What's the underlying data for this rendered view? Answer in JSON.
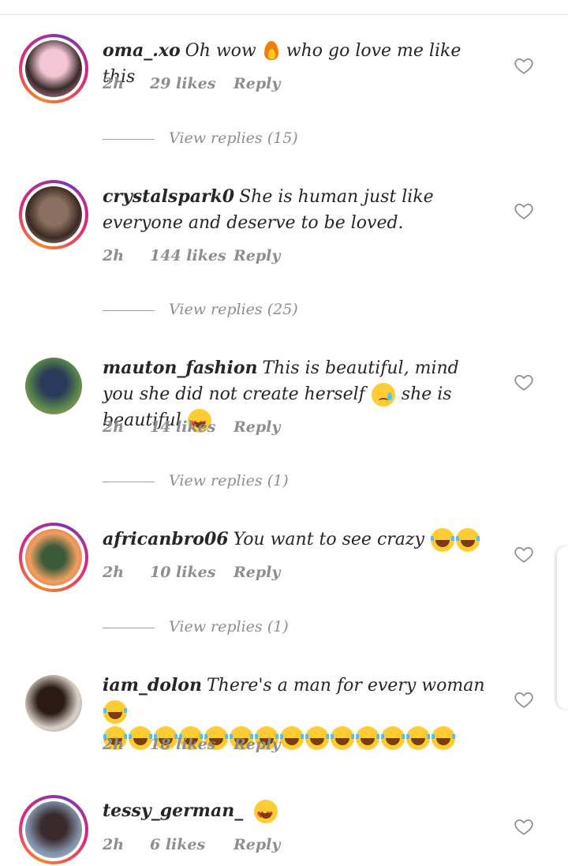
{
  "comments": [
    {
      "username": "oma_.xo",
      "text_parts": [
        "Oh wow",
        "who go love me like this"
      ],
      "time": "2h",
      "likes": "29 likes",
      "reply": "Reply",
      "view_replies": "View replies (15)",
      "avatar_colors": [
        "#f3c6d6",
        "#3a2a2a"
      ]
    },
    {
      "username": "crystalspark0",
      "text": "She is human just like everyone and deserve to be loved.",
      "time": "2h",
      "likes": "144 likes",
      "reply": "Reply",
      "view_replies": "View replies (25)",
      "avatar_colors": [
        "#8a7060",
        "#3a2a22"
      ]
    },
    {
      "username": "mauton_fashion",
      "text_parts": [
        "This is beautiful, mind you she did not create herself",
        "she is beautiful"
      ],
      "time": "2h",
      "likes": "14 likes",
      "reply": "Reply",
      "view_replies": "View replies (1)",
      "avatar_colors": [
        "#5a8a4a",
        "#2a3a5a"
      ]
    },
    {
      "username": "africanbro06",
      "text": "You want to see crazy",
      "time": "2h",
      "likes": "10 likes",
      "reply": "Reply",
      "view_replies": "View replies (1)",
      "avatar_colors": [
        "#f0a060",
        "#3a5a3a"
      ]
    },
    {
      "username": "iam_dolon",
      "text": "There's a man for every woman",
      "time": "2h",
      "likes": "18 likes",
      "reply": "Reply",
      "avatar_colors": [
        "#d8d0c8",
        "#2a1a12"
      ]
    },
    {
      "username": "tessy_german_",
      "time": "2h",
      "likes": "6 likes",
      "reply": "Reply",
      "avatar_colors": [
        "#8090a8",
        "#3a2a2a"
      ]
    }
  ],
  "icons": {
    "like": "heart-outline-icon"
  },
  "colors": {
    "ring_start": "#f58529",
    "ring_mid": "#dd2a7b",
    "meta_text": "#8e8e8e"
  }
}
